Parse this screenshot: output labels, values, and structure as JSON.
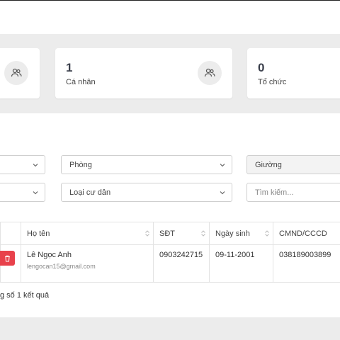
{
  "stats": [
    {
      "value": "1",
      "label": "Cá nhân",
      "icon": "users-icon"
    },
    {
      "value": "0",
      "label": "Tổ chức"
    }
  ],
  "filters": {
    "room": "Phòng",
    "bed": "Giường",
    "resident_type": "Loại cư dân",
    "search_placeholder": "Tìm kiếm..."
  },
  "table": {
    "columns": [
      "Họ tên",
      "SĐT",
      "Ngày sinh",
      "CMND/CCCD"
    ],
    "rows": [
      {
        "name": "Lê Ngọc Anh",
        "email": "lengocan15@gmail.com",
        "phone": "0903242715",
        "dob": "09-11-2001",
        "id_number": "038189003899"
      }
    ]
  },
  "footer": {
    "result_text": "g số 1 kết quả"
  },
  "colors": {
    "delete": "#e8414b",
    "background": "#ececec"
  }
}
